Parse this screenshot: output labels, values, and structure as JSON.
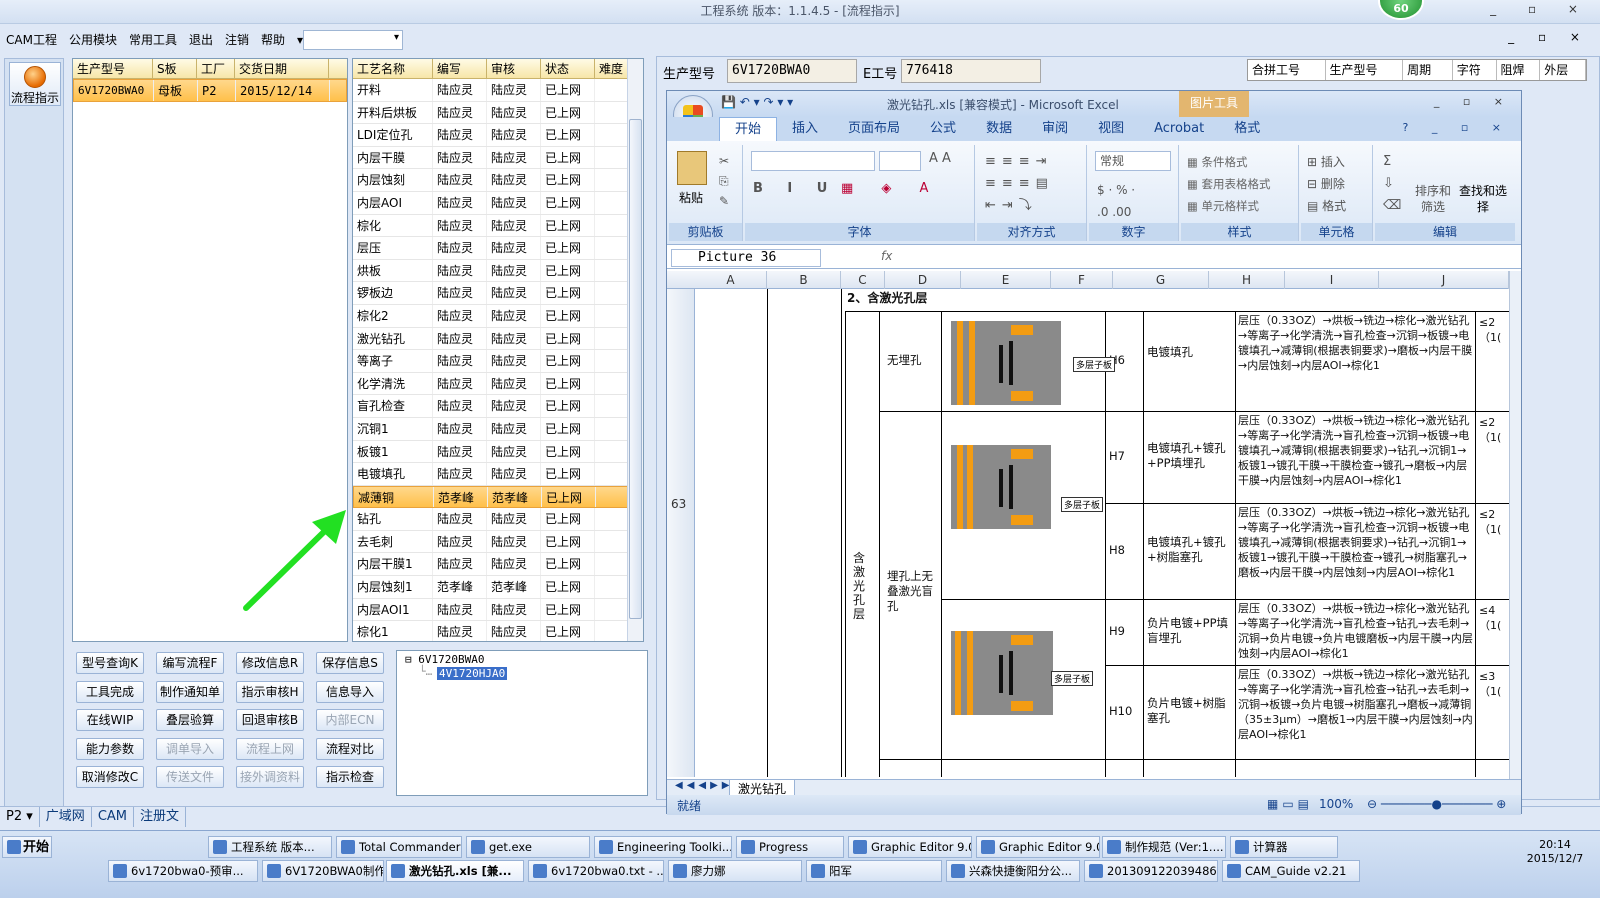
{
  "window": {
    "title": "工程系统 版本：1.1.4.5 - [流程指示]",
    "badge": "60",
    "controls": "_ ▫ ×"
  },
  "menu": [
    "CAM工程",
    "公用模块",
    "常用工具",
    "退出",
    "注销",
    "帮助"
  ],
  "menu_right_controls": "_ ▫ ×",
  "leftnav": {
    "flow_label": "流程指示"
  },
  "grid1": {
    "headers": [
      "生产型号",
      "S板",
      "工厂",
      "交货日期"
    ],
    "rows": [
      [
        "6V1720BWA0",
        "母板",
        "P2",
        "2015/12/14"
      ]
    ]
  },
  "grid2": {
    "headers": [
      "工艺名称",
      "编写",
      "审核",
      "状态",
      "难度"
    ],
    "rows": [
      [
        "开料",
        "陆应灵",
        "陆应灵",
        "已上网",
        ""
      ],
      [
        "开料后烘板",
        "陆应灵",
        "陆应灵",
        "已上网",
        ""
      ],
      [
        "LDI定位孔",
        "陆应灵",
        "陆应灵",
        "已上网",
        ""
      ],
      [
        "内层干膜",
        "陆应灵",
        "陆应灵",
        "已上网",
        ""
      ],
      [
        "内层蚀刻",
        "陆应灵",
        "陆应灵",
        "已上网",
        ""
      ],
      [
        "内层AOI",
        "陆应灵",
        "陆应灵",
        "已上网",
        ""
      ],
      [
        "棕化",
        "陆应灵",
        "陆应灵",
        "已上网",
        ""
      ],
      [
        "层压",
        "陆应灵",
        "陆应灵",
        "已上网",
        ""
      ],
      [
        "烘板",
        "陆应灵",
        "陆应灵",
        "已上网",
        ""
      ],
      [
        "锣板边",
        "陆应灵",
        "陆应灵",
        "已上网",
        ""
      ],
      [
        "棕化2",
        "陆应灵",
        "陆应灵",
        "已上网",
        ""
      ],
      [
        "激光钻孔",
        "陆应灵",
        "陆应灵",
        "已上网",
        ""
      ],
      [
        "等离子",
        "陆应灵",
        "陆应灵",
        "已上网",
        ""
      ],
      [
        "化学清洗",
        "陆应灵",
        "陆应灵",
        "已上网",
        ""
      ],
      [
        "盲孔检查",
        "陆应灵",
        "陆应灵",
        "已上网",
        ""
      ],
      [
        "沉铜1",
        "陆应灵",
        "陆应灵",
        "已上网",
        ""
      ],
      [
        "板镀1",
        "陆应灵",
        "陆应灵",
        "已上网",
        ""
      ],
      [
        "电镀填孔",
        "陆应灵",
        "陆应灵",
        "已上网",
        ""
      ],
      [
        "减薄铜",
        "范孝峰",
        "范孝峰",
        "已上网",
        ""
      ],
      [
        "钻孔",
        "陆应灵",
        "陆应灵",
        "已上网",
        ""
      ],
      [
        "去毛刺",
        "陆应灵",
        "陆应灵",
        "已上网",
        ""
      ],
      [
        "内层干膜1",
        "陆应灵",
        "陆应灵",
        "已上网",
        ""
      ],
      [
        "内层蚀刻1",
        "范孝峰",
        "范孝峰",
        "已上网",
        ""
      ],
      [
        "内层AOI1",
        "陆应灵",
        "陆应灵",
        "已上网",
        ""
      ],
      [
        "棕化1",
        "陆应灵",
        "陆应灵",
        "已上网",
        ""
      ]
    ],
    "selected_index": 18
  },
  "buttons": [
    [
      "型号查询K",
      "编写流程F",
      "修改信息R",
      "保存信息S"
    ],
    [
      "工具完成",
      "制作通知单",
      "指示审核H",
      "信息导入"
    ],
    [
      "在线WIP",
      "叠层验算",
      "回退审核B",
      "内部ECN"
    ],
    [
      "能力参数",
      "调单导入",
      "流程上网",
      "流程对比"
    ],
    [
      "取消修改C",
      "传送文件",
      "接外调资料",
      "指示检查"
    ]
  ],
  "disabled_buttons": [
    "内部ECN",
    "调单导入",
    "流程上网",
    "传送文件",
    "接外调资料"
  ],
  "tree": {
    "root": "6V1720BWA0",
    "child": "4V1720HJA0"
  },
  "bottom_tabs": [
    "P2",
    "广域网",
    "CAM",
    "注册文"
  ],
  "rightpanel": {
    "model_label": "生产型号",
    "model_value": "6V1720BWA0",
    "eno_label": "E工号",
    "eno_value": "776418",
    "headers": [
      "合拼工号",
      "生产型号",
      "周期",
      "字符",
      "阻焊",
      "外层"
    ]
  },
  "excel": {
    "title": "激光钻孔.xls [兼容模式] - Microsoft Excel",
    "picture_tools": "图片工具",
    "tabs": [
      "开始",
      "插入",
      "页面布局",
      "公式",
      "数据",
      "审阅",
      "视图",
      "Acrobat",
      "格式"
    ],
    "groups": [
      "剪贴板",
      "字体",
      "对齐方式",
      "数字",
      "样式",
      "单元格",
      "编辑"
    ],
    "ribbon": {
      "paste": "粘贴",
      "number_format": "常规",
      "cond_fmt": "条件格式",
      "table_fmt": "套用表格格式",
      "cell_style": "单元格样式",
      "insert": "插入",
      "delete": "删除",
      "format": "格式",
      "sort": "排序和筛选",
      "find": "查找和选择"
    },
    "namebox": "Picture 36",
    "fx": "fx",
    "cols": [
      "A",
      "B",
      "C",
      "D",
      "E",
      "F",
      "G",
      "H",
      "I",
      "J"
    ],
    "row_no": "63",
    "section_title": "2、含激光孔层",
    "left_vertical": "含激光孔层",
    "group1": "无埋孔",
    "group2": "埋孔上无叠激光盲孔",
    "tag": "多层子板",
    "rows": [
      {
        "code": "H6",
        "name": "电镀填孔",
        "flow": "层压（0.33OZ）→烘板→铣边→棕化→激光钻孔→等离子→化学清洗→盲孔检查→沉铜→板镀→电镀填孔→减薄铜(根据表铜要求)→磨板→内层干膜→内层蚀刻→内层AOI→棕化1",
        "cap": "≤2（1("
      },
      {
        "code": "H7",
        "name": "电镀填孔+镀孔+PP填埋孔",
        "flow": "层压（0.33OZ）→烘板→铣边→棕化→激光钻孔→等离子→化学清洗→盲孔检查→沉铜→板镀→电镀填孔→减薄铜(根据表铜要求)→钻孔→沉铜1→板镀1→镀孔干膜→干膜检查→镀孔→磨板→内层干膜→内层蚀刻→内层AOI→棕化1",
        "cap": "≤2（1("
      },
      {
        "code": "H8",
        "name": "电镀填孔+镀孔+树脂塞孔",
        "flow": "层压（0.33OZ）→烘板→铣边→棕化→激光钻孔→等离子→化学清洗→盲孔检查→沉铜→板镀→电镀填孔→减薄铜(根据表铜要求)→钻孔→沉铜1→板镀1→镀孔干膜→干膜检查→镀孔→树脂塞孔→磨板→内层干膜→内层蚀刻→内层AOI→棕化1",
        "cap": "≤2（1("
      },
      {
        "code": "H9",
        "name": "负片电镀+PP填盲埋孔",
        "flow": "层压（0.33OZ）→烘板→铣边→棕化→激光钻孔→等离子→化学清洗→盲孔检查→钻孔→去毛刺→沉铜→负片电镀→负片电镀磨板→内层干膜→内层蚀刻→内层AOI→棕化1",
        "cap": "≤4（1("
      },
      {
        "code": "H10",
        "name": "负片电镀+树脂塞孔",
        "flow": "层压（0.33OZ）→烘板→铣边→棕化→激光钻孔→等离子→化学清洗→盲孔检查→钻孔→去毛刺→沉铜→板镀→负片电镀→树脂塞孔→磨板→减薄铜（35±3μm）→磨板1→内层干膜→内层蚀刻→内层AOI→棕化1",
        "cap": "≤3（1("
      }
    ],
    "sheet_tab": "激光钻孔",
    "status": "就绪",
    "zoom": "100%"
  },
  "taskbar": {
    "start": "开始",
    "row1": [
      "工程系统 版本...",
      "Total Commander ...",
      "get.exe",
      "Engineering Toolki...",
      "Progress",
      "Graphic Editor 9.0...",
      "Graphic Editor 9.0...",
      "制作规范 (Ver:1....",
      "计算器"
    ],
    "row2": [
      "6v1720bwa0-预审...",
      "6V1720BWA0制作单...",
      "激光钻孔.xls [兼...",
      "6v1720bwa0.txt - ...",
      "廖力娜",
      "阳军",
      "兴森快捷衡阳分公...",
      "2013091220394868...",
      "CAM_Guide v2.21"
    ],
    "time": "20:14",
    "date": "2015/12/7"
  },
  "colors": {
    "accent": "#ffc04a",
    "arrow": "#22e022",
    "chrome": "#dfe8f6"
  }
}
